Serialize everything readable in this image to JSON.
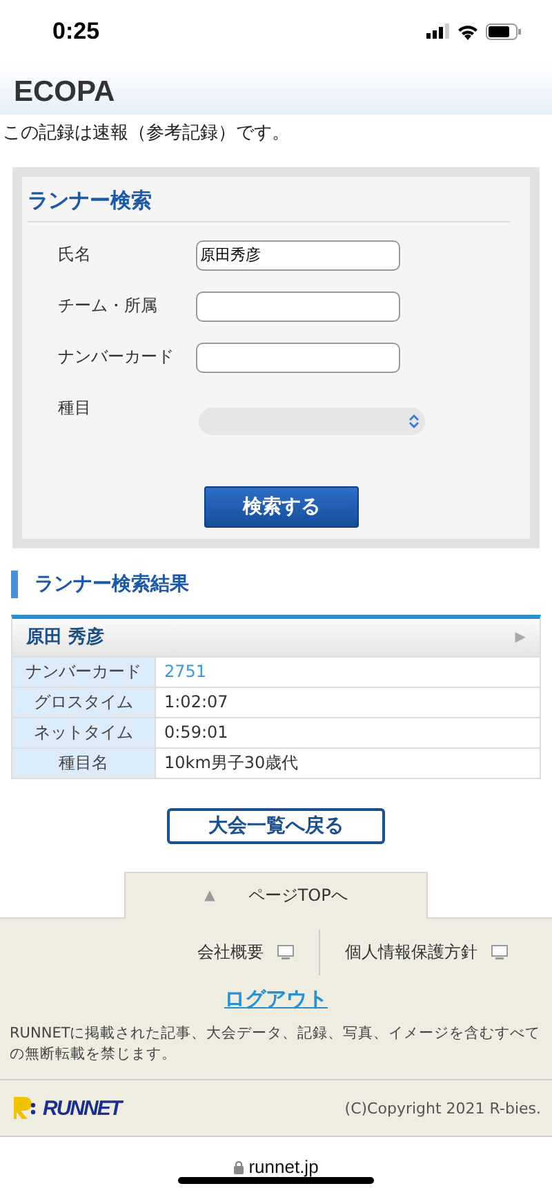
{
  "status_bar": {
    "time": "0:25"
  },
  "page_title": "ECOPA",
  "notice": "この記録は速報（参考記録）です。",
  "search_form": {
    "title": "ランナー検索",
    "fields": [
      {
        "label": "氏名",
        "kind": "text",
        "value": "原田秀彦"
      },
      {
        "label": "チーム・所属",
        "kind": "text"
      },
      {
        "label": "ナンバーカード",
        "kind": "text"
      },
      {
        "label": "種目",
        "kind": "select"
      }
    ],
    "submit": "検索する"
  },
  "results": {
    "title": "ランナー検索結果",
    "runner_name": "原田 秀彦",
    "expand_icon": "▶",
    "rows": [
      {
        "label": "ナンバーカード",
        "value": "2751",
        "kind": "link"
      },
      {
        "label": "グロスタイム",
        "value": "1:02:07",
        "kind": "text"
      },
      {
        "label": "ネットタイム",
        "value": "0:59:01",
        "kind": "text"
      },
      {
        "label": "種目名",
        "value": "10km男子30歳代",
        "kind": "text"
      }
    ]
  },
  "back_button": "大会一覧へ戻る",
  "footer": {
    "page_top": "ページTOPへ",
    "page_top_icon": "▲",
    "links": [
      "会社概要",
      "個人情報保護方針"
    ],
    "logout": "ログアウト",
    "notice": "RUNNETに掲載された記事、大会データ、記録、写真、イメージを含むすべての無断転載を禁じます。",
    "logo": "RUNNET",
    "copyright": "(C)Copyright 2021 R-bies."
  },
  "browser": {
    "url": "runnet.jp"
  }
}
